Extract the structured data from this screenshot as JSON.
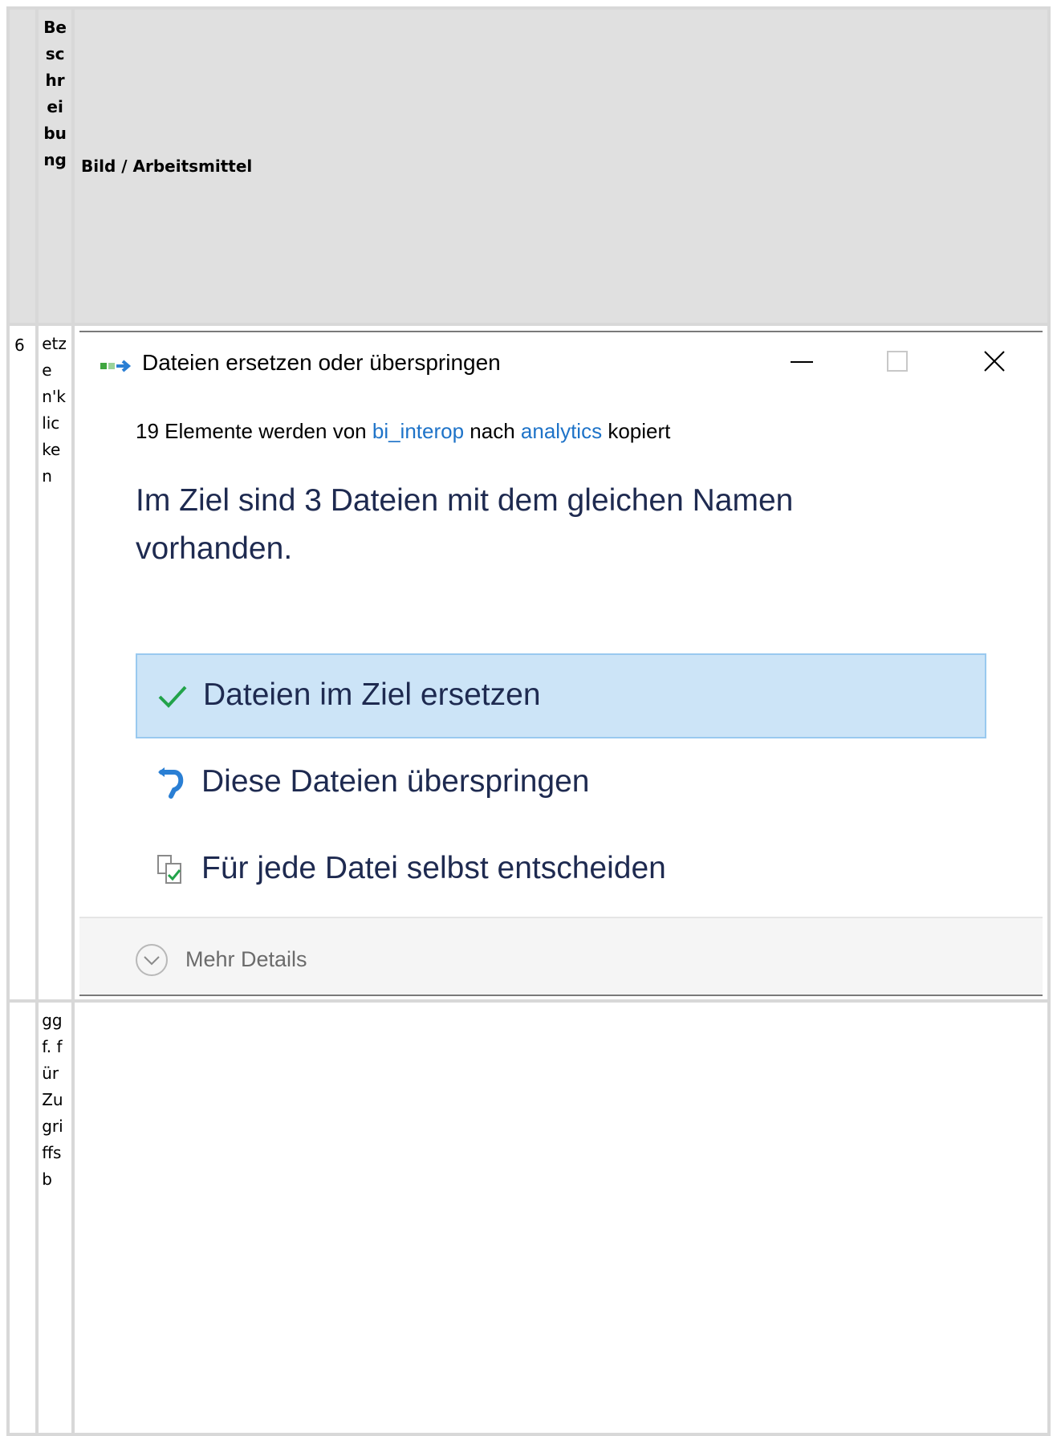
{
  "table": {
    "header_col1": "Beschreibung",
    "header_col2": "Bild / Arbeitsmittel",
    "row1_number": "6",
    "row1_description": "etzen'klicken",
    "row2_description": "ggf. für Zugriffsb"
  },
  "dialog": {
    "title": "Dateien ersetzen oder überspringen",
    "summary_prefix": "19 Elemente werden von",
    "summary_source": "bi_interop",
    "summary_middle": "nach",
    "summary_target": "analytics",
    "summary_suffix": "kopiert",
    "heading": "Im Ziel sind 3 Dateien mit dem gleichen Namen vorhanden.",
    "options": [
      {
        "label": "Dateien im Ziel ersetzen",
        "icon": "checkmark-icon",
        "selected": true
      },
      {
        "label": "Diese Dateien überspringen",
        "icon": "skip-arrow-icon",
        "selected": false
      },
      {
        "label": "Für jede Datei selbst entscheiden",
        "icon": "compare-files-icon",
        "selected": false
      }
    ],
    "more_details": "Mehr Details"
  },
  "colors": {
    "selected_bg": "#cce4f7",
    "selected_border": "#99c9ef",
    "link": "#1e73c8",
    "text_dark": "#1e2a50"
  }
}
